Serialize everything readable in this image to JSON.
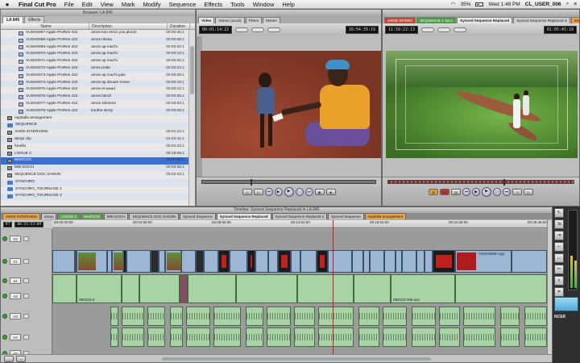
{
  "menubar": {
    "app_name": "Final Cut Pro",
    "items": [
      "File",
      "Edit",
      "View",
      "Mark",
      "Modify",
      "Sequence",
      "Effects",
      "Tools",
      "Window",
      "Help"
    ],
    "battery": "35%",
    "clock": "Wed 1:48 PM",
    "user": "CL_USER_006"
  },
  "browser": {
    "title": "Browser: LA 845",
    "tabs": [
      "LA 845",
      "Effects"
    ],
    "columns": [
      "Name",
      "Description",
      "Duration"
    ],
    "rows": [
      {
        "name": "VUSH0067-Apple ProRes 422",
        "desc": "amos kon emor yoa plonin",
        "dur": "00:00:45:1",
        "kind": "clip"
      },
      {
        "name": "VUSH0068-Apple ProRes 422",
        "desc": "amos nkosa",
        "dur": "00:00:06:1",
        "kind": "clip"
      },
      {
        "name": "VUSH0069-Apple ProRes 422",
        "desc": "amos ap machi",
        "dur": "00:00:02:1",
        "kind": "clip"
      },
      {
        "name": "VUSH0070-Apple ProRes 422",
        "desc": "amos ap machi",
        "dur": "00:00:13:1",
        "kind": "clip"
      },
      {
        "name": "VUSH0071-Apple ProRes 422",
        "desc": "amos ap machi",
        "dur": "00:00:02:1",
        "kind": "clip"
      },
      {
        "name": "VUSH0072-Apple ProRes 422",
        "desc": "amos prale",
        "dur": "00:00:24:1",
        "kind": "clip"
      },
      {
        "name": "VUSH0073-Apple ProRes 422",
        "desc": "amos ap machi yalo",
        "dur": "00:00:08:1",
        "kind": "clip"
      },
      {
        "name": "VUSH0074-Apple ProRes 422",
        "desc": "amos ap douam mone",
        "dur": "00:00:15:1",
        "kind": "clip"
      },
      {
        "name": "VUSH0075-Apple ProRes 422",
        "desc": "amos et waad",
        "dur": "00:00:12:1",
        "kind": "clip"
      },
      {
        "name": "VUSH0076-Apple ProRes 422",
        "desc": "amos bitrull",
        "dur": "00:00:05:1",
        "kind": "clip"
      },
      {
        "name": "VUSH0077-Apple ProRes 422",
        "desc": "amos siimeme",
        "dur": "00:00:03:1",
        "kind": "clip"
      },
      {
        "name": "VUSH0078-Apple ProRes 422",
        "desc": "kouthe simty",
        "dur": "00:00:09:1",
        "kind": "clip"
      },
      {
        "name": "nsphalla arrangement",
        "desc": "",
        "dur": "",
        "kind": "seq"
      },
      {
        "name": "SEQUENCE",
        "desc": "",
        "dur": "",
        "kind": "folder"
      },
      {
        "name": "ANGE INTERVIEW",
        "desc": "",
        "dur": "00:01:23:1",
        "kind": "seq"
      },
      {
        "name": "dorqo clip",
        "desc": "",
        "dur": "01:04:41:1",
        "kind": "seq"
      },
      {
        "name": "fonello",
        "desc": "",
        "dur": "00:02:23:1",
        "kind": "seq"
      },
      {
        "name": "LOGUE 2",
        "desc": "",
        "dur": "00:18:06:1",
        "kind": "seq"
      },
      {
        "name": "MARCOS",
        "desc": "",
        "dur": "00:07:55:1",
        "kind": "seq",
        "selected": true
      },
      {
        "name": "MIE-DOCU",
        "desc": "",
        "dur": "00:03:38:1",
        "kind": "seq"
      },
      {
        "name": "SEQUENCE DOC SANON",
        "desc": "",
        "dur": "00:02:43:1",
        "kind": "seq"
      },
      {
        "name": "SYNCHRO",
        "desc": "",
        "dur": "",
        "kind": "folder"
      },
      {
        "name": "SYNCHRO_TOURNAGE 1",
        "desc": "",
        "dur": "",
        "kind": "folder"
      },
      {
        "name": "SYNCHRO_TOURNAGE 2",
        "desc": "",
        "dur": "",
        "kind": "folder"
      }
    ]
  },
  "viewer": {
    "tabs": [
      "Video",
      "Stereo (a1a2)",
      "Filters",
      "Motion"
    ],
    "timecode_left": "00:01:14:22",
    "timecode_right": "10:54:35:19"
  },
  "canvas": {
    "tabs": [
      "ANGE INTERV",
      "SEQUENCE 2 Sync",
      "Synced Sequence Replaced",
      "Synced Sequence Replaced in",
      "sequence"
    ],
    "timecode_left": "11:59:22:13",
    "timecode_right": "01:05:45:18"
  },
  "timeline": {
    "title": "Timeline: Synced Sequence Replaced in LA 845",
    "tabs": [
      {
        "label": "ANGE INTERVIEW",
        "style": "orange"
      },
      {
        "label": "dorqo",
        "style": "plain"
      },
      {
        "label": "LOGUE 2",
        "style": "green"
      },
      {
        "label": "MARCOS",
        "style": "green"
      },
      {
        "label": "MIE-DOCU",
        "style": "plain"
      },
      {
        "label": "SEQUENCE DOC SANON",
        "style": "plain"
      },
      {
        "label": "Synced Sequence",
        "style": "plain"
      },
      {
        "label": "Synced Sequence Replaced",
        "style": "active"
      },
      {
        "label": "Synced Sequence Replaced 2",
        "style": "plain"
      },
      {
        "label": "Synced Sequence",
        "style": "plain"
      },
      {
        "label": "nsphalla arrangement",
        "style": "orange"
      }
    ],
    "rt_label": "RT",
    "current_tc": "00:15:53:09",
    "ruler_ticks": [
      "00:00:00:00",
      "00:04:58:00",
      "00:09:56:00",
      "00:14:54:00",
      "00:19:52:00",
      "00:24:50:00",
      "00:29:48:00"
    ],
    "track_labels": {
      "v2": "V2",
      "v1": "V1",
      "a1": "a1",
      "a2": "A2",
      "a3": "A3",
      "a4": "A4",
      "a5": "A5"
    },
    "clip_labels": {
      "v_end": "VUSH0059-App",
      "a_mid": "0B0102-0",
      "a_end": "0B0102-005.aac"
    }
  },
  "tools": {
    "tile_label": "NCER"
  }
}
